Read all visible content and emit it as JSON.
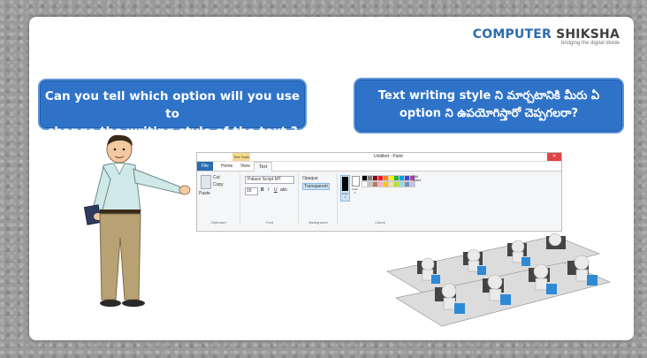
{
  "logo": {
    "name_part1": "COMPUTER",
    "name_part2": "SHIKSHA",
    "tagline": "bridging the digital divide"
  },
  "question_english": {
    "line1": "Can you tell which option will you use to",
    "line2": "change the writing style of the text ?"
  },
  "question_telugu": {
    "line1": "Text writing style ని మార్చటానికి మీరు ఏ",
    "line2": "option ని ఉపయోగిస్తారో చెప్పగలరా?"
  },
  "paint_window": {
    "title": "Untitled - Paint",
    "context_tab": "Text Tools",
    "tabs": [
      "File",
      "Home",
      "View",
      "Text"
    ],
    "clipboard": {
      "paste": "Paste",
      "cut": "Cut",
      "copy": "Copy",
      "label": "Clipboard"
    },
    "font": {
      "name": "Palace Script MT",
      "size": "16",
      "label": "Font"
    },
    "background": {
      "opaque": "Opaque",
      "transparent": "Transparent",
      "label": "Background"
    },
    "colors": {
      "color1": "Color 1",
      "color2": "Color 2",
      "edit": "Edit colors",
      "label": "Colors"
    },
    "palette": [
      "#000000",
      "#7f7f7f",
      "#880015",
      "#ed1c24",
      "#ff7f27",
      "#fff200",
      "#22b14c",
      "#00a2e8",
      "#3f48cc",
      "#a349a4",
      "#ffffff",
      "#c3c3c3",
      "#b97a57",
      "#ffaec9",
      "#ffc90e",
      "#efe4b0",
      "#b5e61d",
      "#99d9ea",
      "#7092be",
      "#c8bfe7"
    ]
  }
}
